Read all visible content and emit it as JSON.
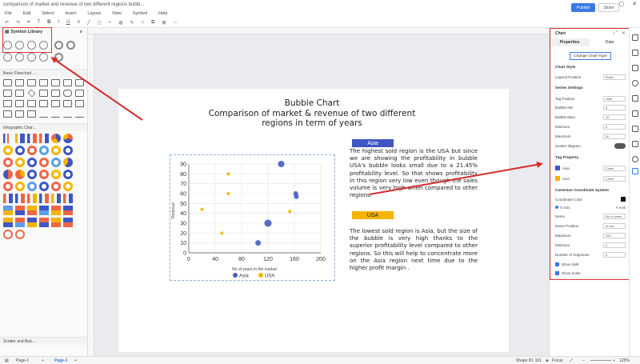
{
  "window": {
    "title": "comparison of market and revenue of two different regions bubbl..."
  },
  "menu": [
    "File",
    "Edit",
    "Select",
    "Insert",
    "Layout",
    "View",
    "Symbol",
    "Help"
  ],
  "header": {
    "publish_label": "Publish",
    "share_label": "Share"
  },
  "left_panel": {
    "title": "Symbol Library",
    "sections": [
      "Basic Flowchart ...",
      "Infographic Char...",
      "Scatter and Bub..."
    ]
  },
  "canvas": {
    "title_line1": "Bubble Chart",
    "title_line2": "Comparison of market & revenue of two different",
    "title_line3": "regions in term of years",
    "asia_label": "Asia",
    "usa_label": "USA",
    "asia_text": "The highest sold region is the USA but since we are showing the profitability in bubble USA's bubble looks small due to a 21.45% profitability level. So that shows profitability in this region very low even though the sales volume is very high when compared to other regions.",
    "usa_text": "The lowest sold region is Asia, but the size of the bubble is very high thanks to the superior profitability level compared to other regions. So this will help to concentrate more on the Asia region next time due to the higher profit margin ."
  },
  "chart_data": {
    "type": "scatter",
    "xlabel": "No of years in the market",
    "ylabel": "Revenue",
    "xlim": [
      0,
      200
    ],
    "ylim": [
      0,
      90
    ],
    "xticks": [
      0,
      40,
      80,
      120,
      160,
      200
    ],
    "yticks": [
      0,
      10,
      20,
      30,
      40,
      50,
      60,
      70,
      80,
      90
    ],
    "legend_position": "bottom",
    "series": [
      {
        "name": "Asia",
        "color": "#4a5fc1",
        "points": [
          [
            140,
            90
          ],
          [
            162,
            60
          ],
          [
            163,
            57
          ],
          [
            120,
            30
          ],
          [
            105,
            10
          ]
        ],
        "sizes": [
          8,
          6,
          6,
          9,
          7
        ]
      },
      {
        "name": "USA",
        "color": "#f5b400",
        "points": [
          [
            60,
            80
          ],
          [
            60,
            60
          ],
          [
            20,
            44
          ],
          [
            153,
            42
          ],
          [
            50,
            20
          ]
        ],
        "sizes": [
          4,
          4,
          4,
          4,
          4
        ]
      }
    ]
  },
  "right_panel": {
    "header": "Chart",
    "tabs": [
      "Properties",
      "Data"
    ],
    "change_type_label": "Change Chart Type",
    "chart_style": "Chart Style",
    "legend_position_label": "Legend Position",
    "legend_position_value": "Botto...",
    "series_settings": "Series Settings",
    "tag_position_label": "Tag Position",
    "tag_position_value": "Hide",
    "bubble_min_label": "Bubble Min",
    "bubble_min_value": "8",
    "bubble_max_label": "Bubble Maxi",
    "bubble_max_value": "16",
    "minimum_label": "Minimum",
    "minimum_value": "0",
    "maximum_label": "Maximum",
    "maximum_value": "30",
    "scatter_label": "Scatter diagram",
    "tag_property": "Tag Property",
    "tag_asia": "Asia",
    "tag_usa": "USA",
    "tag_shape": "Circle",
    "cartesian": "Cartesian Coordinate System",
    "coordinate_color": "Coordinate Color",
    "x_axis": "X Axis",
    "y_axis": "Y Axis",
    "name_label": "Name",
    "name_value": "No of years",
    "name_position_label": "Name Position",
    "name_position_value": "In the...",
    "axis_max_label": "Maximum",
    "axis_max_value": "200",
    "axis_min_label": "Minimum",
    "axis_min_value": "0",
    "segments_label": "Number of Segments",
    "segments_value": "5",
    "show_split": "Show Split",
    "show_scale": "Show Scale"
  },
  "status": {
    "page_selector": "Page-1",
    "page_tab": "Page-1",
    "shape_id": "Shape ID: 101",
    "focus": "Focus",
    "zoom": "125%"
  }
}
